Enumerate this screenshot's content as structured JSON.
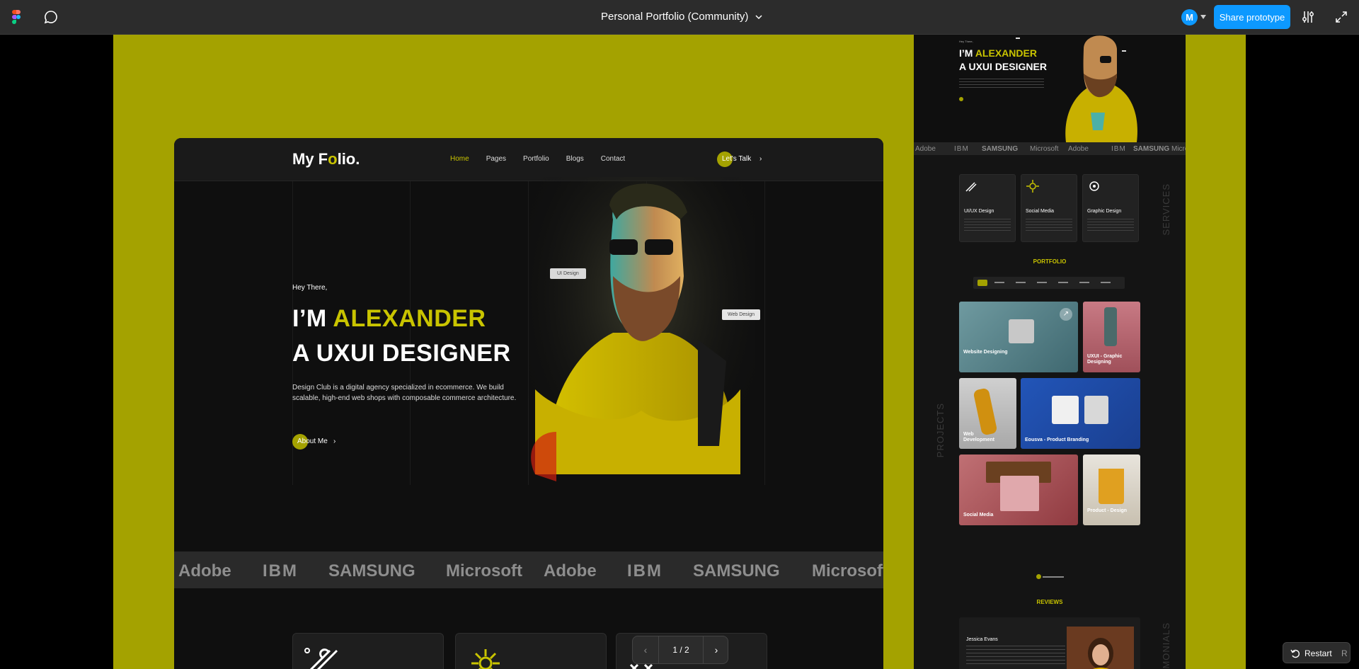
{
  "toolbar": {
    "file_title": "Personal Portfolio (Community)",
    "avatar_initial": "M",
    "share_label": "Share prototype"
  },
  "site": {
    "logo_main": "My F",
    "logo_accent": "o",
    "logo_end": "lio.",
    "nav": [
      "Home",
      "Pages",
      "Portfolio",
      "Blogs",
      "Contact"
    ],
    "cta_label": "Let's Talk",
    "hero": {
      "greeting": "Hey There,",
      "title_prefix": "I’M ",
      "title_name": "ALEXANDER",
      "title_line2": "A UXUI DESIGNER",
      "description": "Design Club is a digital agency specialized in ecommerce. We build scalable, high-end web shops with composable commerce architecture.",
      "about_label": "About Me"
    },
    "tags": {
      "ui": "UI Design",
      "web": "Web Design"
    },
    "brands": [
      "Adobe",
      "IBM",
      "SAMSUNG",
      "Microsoft",
      "Adobe",
      "IBM",
      "SAMSUNG",
      "Microsoft"
    ]
  },
  "thumbnail": {
    "greeting": "Hey There,",
    "title_prefix": "I’M ",
    "title_name": "ALEXANDER",
    "title_line2": "A UXUI DESIGNER",
    "brands": [
      "Adobe",
      "IBM",
      "SAMSUNG",
      "Microsoft",
      "Adobe",
      "IBM",
      "SAMSUNG",
      "Microsoft"
    ],
    "services": [
      "UI/UX Design",
      "Social Media",
      "Graphic Design"
    ],
    "services_label": "SERVICES",
    "portfolio_title": "PORTFOLIO",
    "projects_label": "PROJECTS",
    "projects": [
      "Website Designing",
      "UXUI - Graphic Designing",
      "Web Development",
      "Eousva - Product Branding",
      "Social Media",
      "Product - Design"
    ],
    "reviews_title": "REVIEWS",
    "reviewer": "Jessica Evans",
    "testimonials_label": "TESTIMONIALS"
  },
  "pager": {
    "count": "1 / 2"
  },
  "restart": {
    "label": "Restart",
    "shortcut": "R"
  },
  "colors": {
    "accent": "#c9c400",
    "canvas_bg": "#a4a200",
    "figma_blue": "#0d99ff"
  }
}
